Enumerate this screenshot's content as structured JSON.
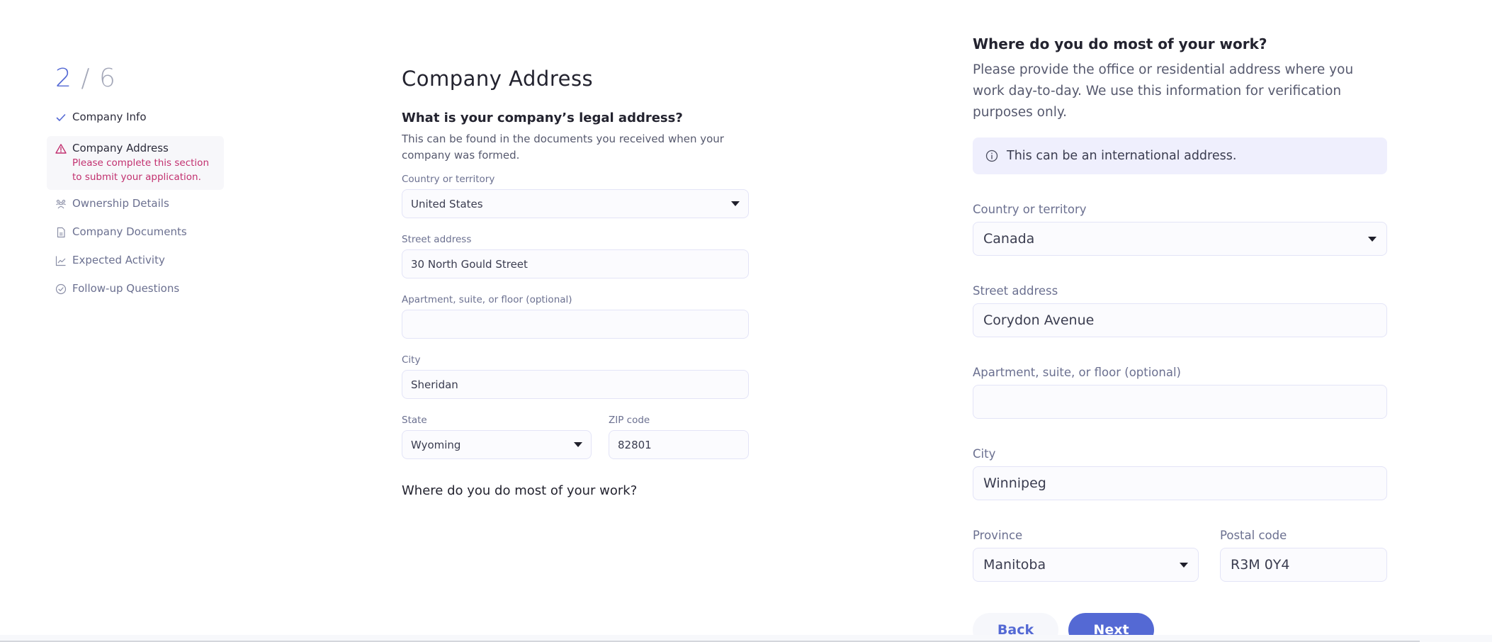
{
  "progress": {
    "current": "2",
    "separator": "/",
    "total": "6"
  },
  "sidebar": {
    "steps": [
      {
        "label": "Company Info",
        "icon": "check-icon",
        "status": "complete"
      },
      {
        "label": "Company Address",
        "icon": "warning-icon",
        "status": "incomplete",
        "message": "Please complete this section to submit your application."
      },
      {
        "label": "Ownership Details",
        "icon": "people-icon",
        "status": "pending"
      },
      {
        "label": "Company Documents",
        "icon": "document-icon",
        "status": "pending"
      },
      {
        "label": "Expected Activity",
        "icon": "chart-icon",
        "status": "pending"
      },
      {
        "label": "Follow-up Questions",
        "icon": "check-circle-icon",
        "status": "pending"
      }
    ]
  },
  "legal_address": {
    "page_title": "Company Address",
    "question": "What is your company’s legal address?",
    "description": "This can be found in the documents you received when your company was formed.",
    "fields": {
      "country": {
        "label": "Country or territory",
        "value": "United States"
      },
      "street": {
        "label": "Street address",
        "value": "30 North Gould Street"
      },
      "apartment": {
        "label": "Apartment, suite, or floor (optional)",
        "value": ""
      },
      "city": {
        "label": "City",
        "value": "Sheridan"
      },
      "state": {
        "label": "State",
        "value": "Wyoming"
      },
      "zip": {
        "label": "ZIP code",
        "value": "82801"
      }
    },
    "next_question_clipped": "Where do you do most of your work?"
  },
  "work_address": {
    "question": "Where do you do most of your work?",
    "description": "Please provide the office or residential address where you work day-to-day. We use this information for verification purposes only.",
    "info_note": "This can be an international address.",
    "fields": {
      "country": {
        "label": "Country or territory",
        "value": "Canada"
      },
      "street": {
        "label": "Street address",
        "value": "Corydon Avenue"
      },
      "apartment": {
        "label": "Apartment, suite, or floor (optional)",
        "value": ""
      },
      "city": {
        "label": "City",
        "value": "Winnipeg"
      },
      "province": {
        "label": "Province",
        "value": "Manitoba"
      },
      "postal": {
        "label": "Postal code",
        "value": "R3M 0Y4"
      }
    }
  },
  "actions": {
    "back_label": "Back",
    "next_label": "Next"
  },
  "colors": {
    "accent": "#5469d4",
    "warning": "#c2306f",
    "info_bg": "#efeffd"
  }
}
